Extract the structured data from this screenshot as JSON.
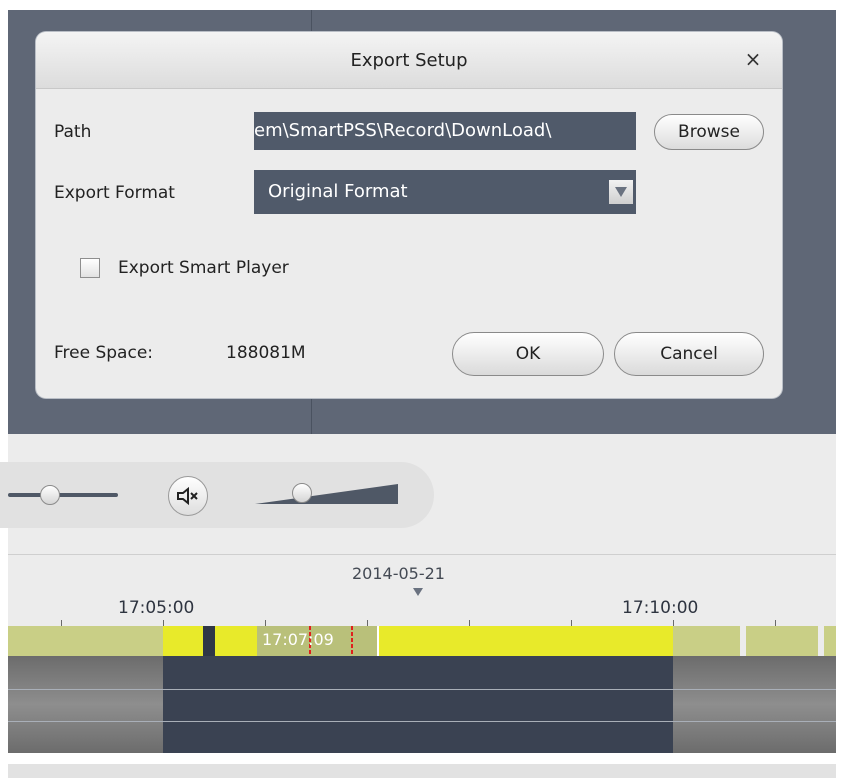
{
  "dialog": {
    "title": "Export Setup",
    "close_label": "×",
    "path_label": "Path",
    "path_value": "em\\SmartPSS\\Record\\DownLoad\\",
    "browse_label": "Browse",
    "format_label": "Export Format",
    "format_value": "Original Format",
    "smart_player_label": "Export Smart Player",
    "smart_player_checked": false,
    "free_space_label": "Free Space:",
    "free_space_value": "188081M",
    "ok_label": "OK",
    "cancel_label": "Cancel"
  },
  "timeline": {
    "date": "2014-05-21",
    "time_left": "17:05:00",
    "time_right": "17:10:00",
    "current_time": "17:07:09"
  },
  "colors": {
    "recording_yellow": "#e8ea2a",
    "recording_dim": "#c9cf86",
    "track_active": "#3a4252",
    "field_bg": "#505a6a"
  },
  "icons": {
    "mute": "speaker-mute-icon",
    "dropdown": "triangle-down-icon",
    "close": "close-icon"
  }
}
